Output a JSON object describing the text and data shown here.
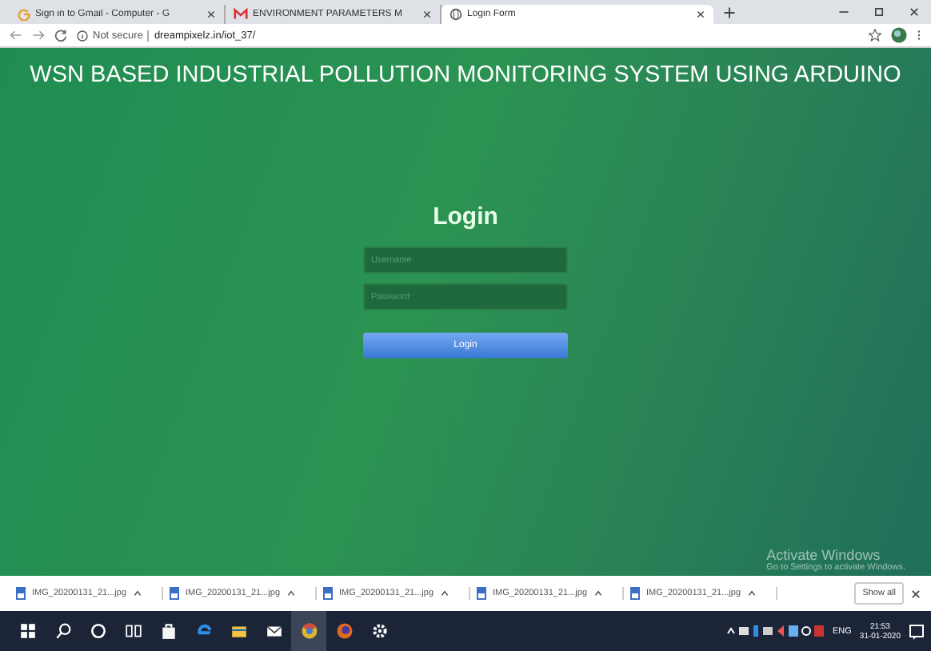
{
  "browser": {
    "tabs": [
      {
        "title": "Sign in to Gmail - Computer - G",
        "selected": false
      },
      {
        "title": "ENVIRONMENT PARAMETERS M",
        "selected": false
      },
      {
        "title": "Login Form",
        "selected": true
      }
    ],
    "security": "Not secure",
    "url": "dreampixelz.in/iot_37/"
  },
  "page": {
    "heading": "WSN BASED INDUSTRIAL POLLUTION MONITORING SYSTEM USING ARDUINO",
    "form": {
      "title": "Login",
      "fields": [
        {
          "placeholder": "Username"
        },
        {
          "placeholder": "Password"
        }
      ],
      "button": "Login"
    },
    "watermark": {
      "title": "Activate Windows",
      "subtitle": "Go to Settings to activate Windows."
    }
  },
  "downloads": {
    "files": [
      "IMG_20200131_21...jpg",
      "IMG_20200131_21...jpg",
      "IMG_20200131_21...jpg",
      "IMG_20200131_21...jpg",
      "IMG_20200131_21...jpg"
    ],
    "show_all": "Show all"
  },
  "taskbar": {
    "language": "ENG",
    "time": "21:53",
    "date": "31-01-2020"
  }
}
